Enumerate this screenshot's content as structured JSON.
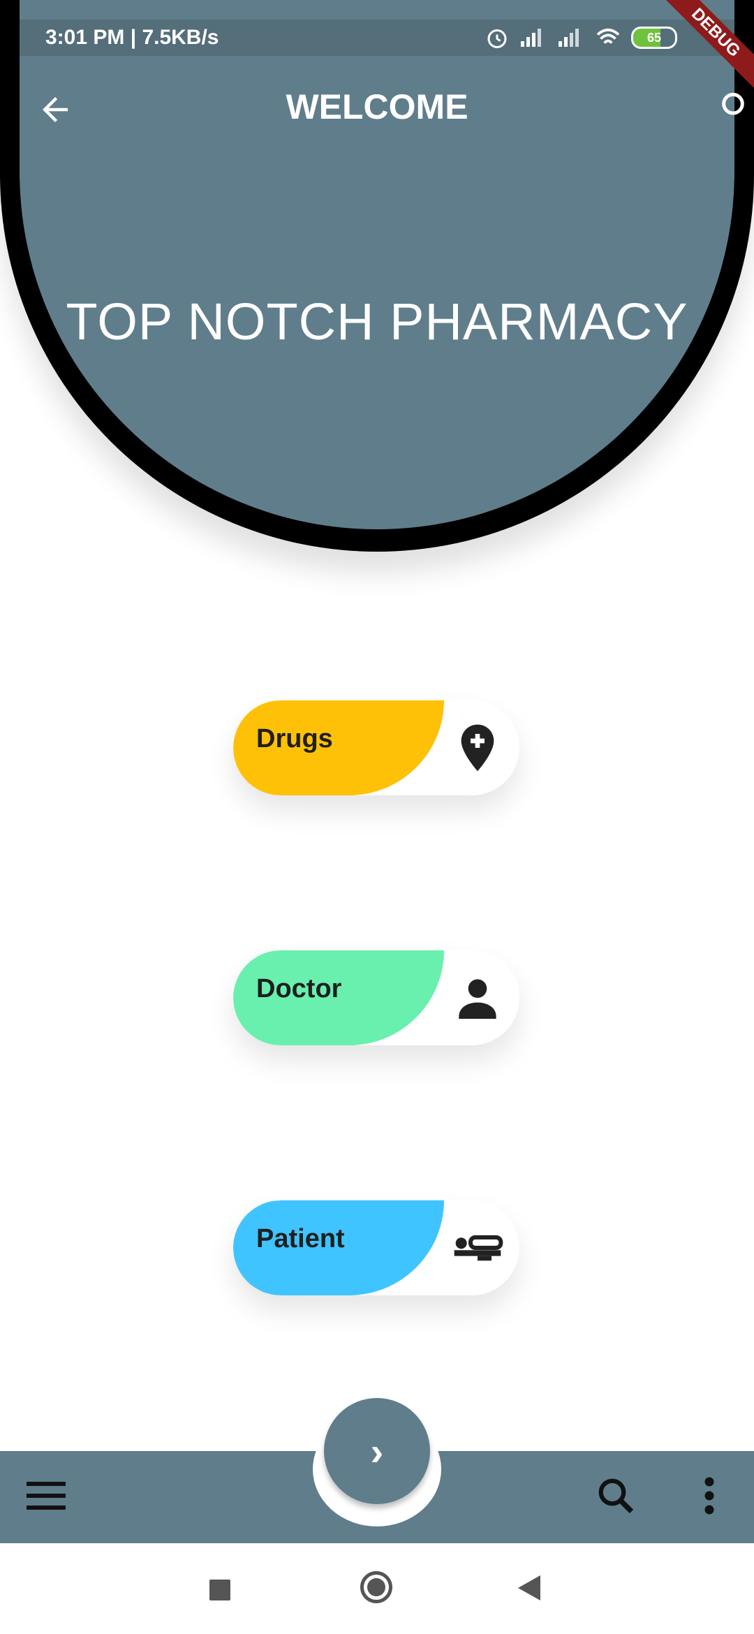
{
  "statusbar": {
    "time_network": "3:01 PM | 7.5KB/s",
    "battery": "65"
  },
  "debug_label": "DEBUG",
  "header": {
    "title": "WELCOME",
    "brand": "TOP NOTCH PHARMACY"
  },
  "cards": [
    {
      "label": "Drugs",
      "color": "#ffc107",
      "icon": "add-location-icon"
    },
    {
      "label": "Doctor",
      "color": "#69f0ae",
      "icon": "person-icon"
    },
    {
      "label": "Patient",
      "color": "#40c4ff",
      "icon": "hotel-bed-icon"
    }
  ],
  "bottom_bar": {
    "fab_symbol": "›"
  },
  "colors": {
    "header": "#607d8b",
    "statusbar": "#546e7a"
  }
}
